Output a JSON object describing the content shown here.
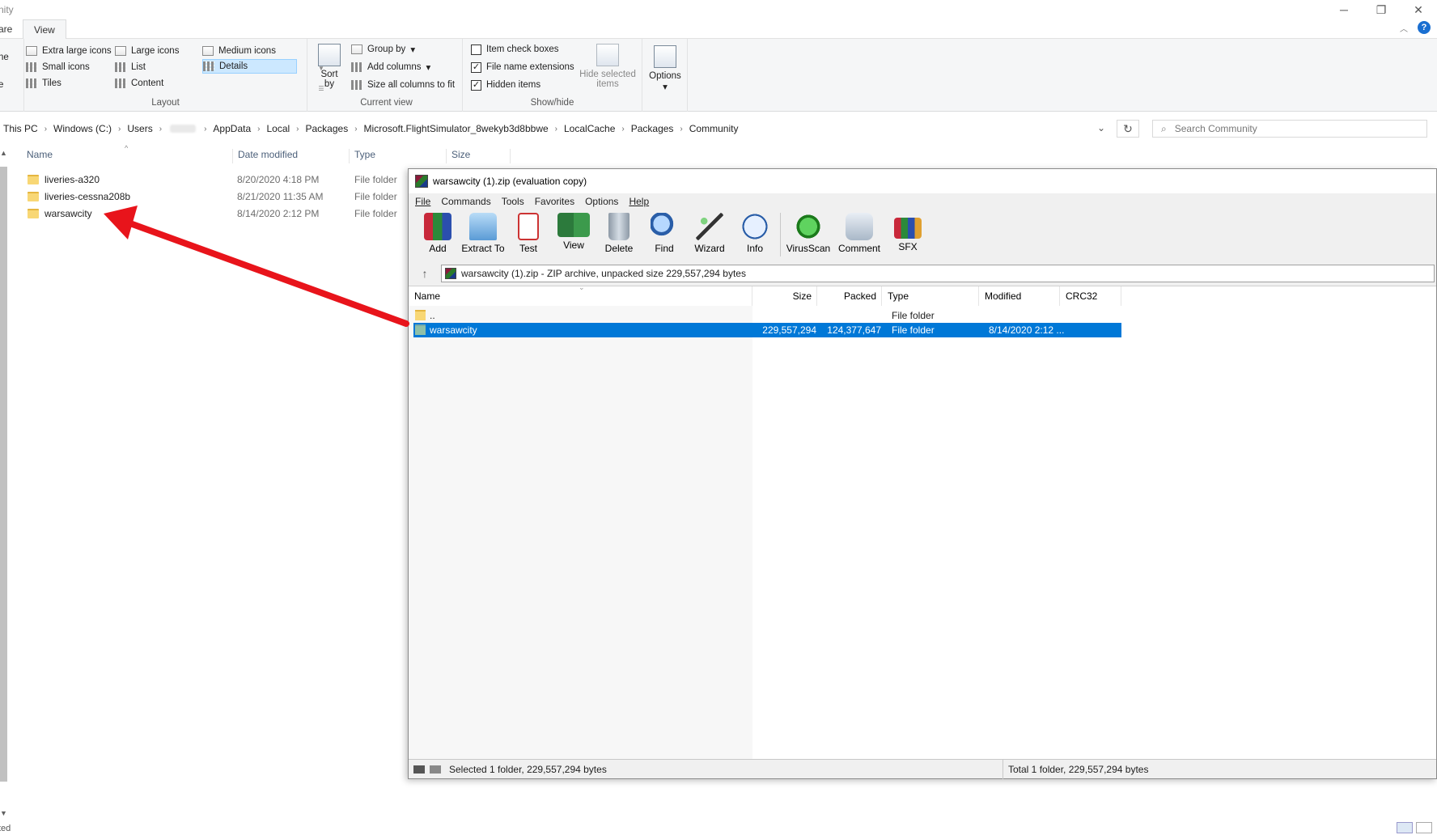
{
  "window": {
    "title": "nity",
    "controls": [
      "─",
      "❐",
      "✕"
    ]
  },
  "ribbon_tabs": {
    "share": "are",
    "view": "View"
  },
  "ribbon": {
    "left_cut": [
      "ne",
      "e"
    ],
    "layout": {
      "label": "Layout",
      "items": [
        "Extra large icons",
        "Large icons",
        "Medium icons",
        "Small icons",
        "List",
        "Details",
        "Tiles",
        "Content"
      ],
      "selected": "Details"
    },
    "current_view": {
      "label": "Current view",
      "sort_by": "Sort",
      "sort_by2": "by",
      "group_by": "Group by",
      "add_columns": "Add columns",
      "size_all": "Size all columns to fit"
    },
    "show_hide": {
      "label": "Show/hide",
      "item_check_boxes": {
        "label": "Item check boxes",
        "checked": false
      },
      "file_name_extensions": {
        "label": "File name extensions",
        "checked": true
      },
      "hidden_items": {
        "label": "Hidden items",
        "checked": true
      },
      "hide_selected": "Hide selected",
      "hide_selected2": "items"
    },
    "options": "Options"
  },
  "address": {
    "crumbs": [
      "This PC",
      "Windows (C:)",
      "Users",
      "",
      "AppData",
      "Local",
      "Packages",
      "Microsoft.FlightSimulator_8wekyb3d8bbwe",
      "LocalCache",
      "Packages",
      "Community"
    ],
    "search_placeholder": "Search Community"
  },
  "explorer": {
    "columns": [
      "Name",
      "Date modified",
      "Type",
      "Size"
    ],
    "rows": [
      {
        "name": "liveries-a320",
        "date": "8/20/2020 4:18 PM",
        "type": "File folder"
      },
      {
        "name": "liveries-cessna208b",
        "date": "8/21/2020 11:35 AM",
        "type": "File folder"
      },
      {
        "name": "warsawcity",
        "date": "8/14/2020 2:12 PM",
        "type": "File folder"
      }
    ],
    "status": "ted"
  },
  "winrar": {
    "title": "warsawcity (1).zip (evaluation copy)",
    "menu": [
      "File",
      "Commands",
      "Tools",
      "Favorites",
      "Options",
      "Help"
    ],
    "toolbar": [
      "Add",
      "Extract To",
      "Test",
      "View",
      "Delete",
      "Find",
      "Wizard",
      "Info",
      "VirusScan",
      "Comment",
      "SFX"
    ],
    "path": "warsawcity (1).zip - ZIP archive, unpacked size 229,557,294 bytes",
    "columns": [
      "Name",
      "Size",
      "Packed",
      "Type",
      "Modified",
      "CRC32"
    ],
    "rows": [
      {
        "name": "..",
        "size": "",
        "packed": "",
        "type": "File folder",
        "modified": ""
      },
      {
        "name": "warsawcity",
        "size": "229,557,294",
        "packed": "124,377,647",
        "type": "File folder",
        "modified": "8/14/2020 2:12 ..."
      }
    ],
    "status_left": "Selected 1 folder, 229,557,294 bytes",
    "status_right": "Total 1 folder, 229,557,294 bytes"
  },
  "colors": {
    "selection": "#0078d7",
    "arrow": "#e8141b",
    "ribbon_bg": "#f5f6f7"
  }
}
